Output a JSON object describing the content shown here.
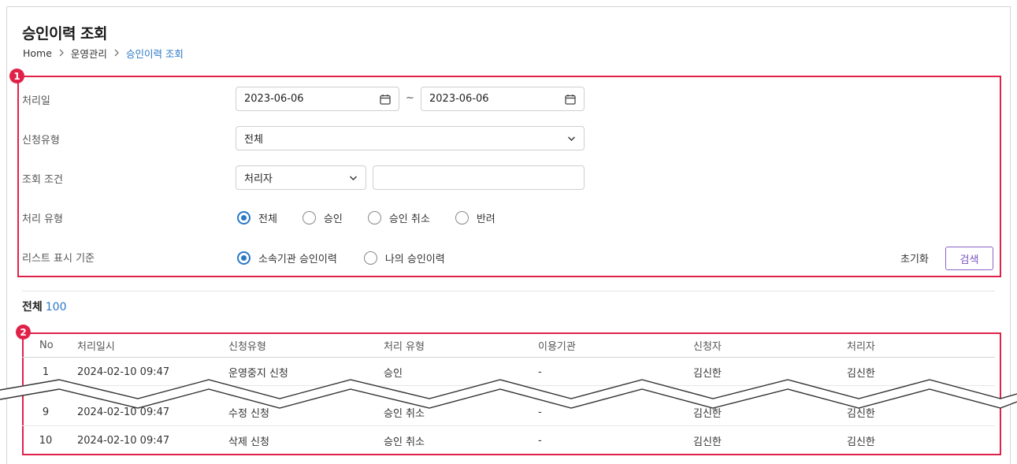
{
  "page": {
    "title": "승인이력 조회",
    "breadcrumb": [
      "Home",
      "운영관리",
      "승인이력 조회"
    ]
  },
  "markers": [
    "1",
    "2"
  ],
  "filters": {
    "date_label": "처리일",
    "date_from": "2023-06-06",
    "date_to": "2023-06-06",
    "date_sep": "~",
    "request_type_label": "신청유형",
    "request_type_value": "전체",
    "search_cond_label": "조회 조건",
    "search_cond_value": "처리자",
    "search_text_value": "",
    "process_type_label": "처리 유형",
    "process_type_options": [
      "전체",
      "승인",
      "승인 취소",
      "반려"
    ],
    "process_type_selected": "전체",
    "list_basis_label": "리스트 표시 기준",
    "list_basis_options": [
      "소속기관 승인이력",
      "나의 승인이력"
    ],
    "list_basis_selected": "소속기관 승인이력",
    "reset_label": "초기화",
    "search_label": "검색"
  },
  "summary": {
    "total_label": "전체",
    "total_count": "100"
  },
  "table": {
    "columns": [
      "No",
      "처리일시",
      "신청유형",
      "처리 유형",
      "이용기관",
      "신청자",
      "처리자"
    ],
    "rows": [
      [
        "1",
        "2024-02-10 09:47",
        "운영중지 신청",
        "승인",
        "-",
        "김신한",
        "김신한"
      ],
      [
        "9",
        "2024-02-10 09:47",
        "수정 신청",
        "승인 취소",
        "-",
        "김신한",
        "김신한"
      ],
      [
        "10",
        "2024-02-10 09:47",
        "삭제 신청",
        "승인 취소",
        "-",
        "김신한",
        "김신한"
      ]
    ]
  },
  "colors": {
    "accent": "#2a78c6",
    "marker": "#e0224a",
    "search_button": "#7a52c0"
  },
  "icons": [
    "calendar-icon",
    "chevron-down-icon",
    "chevron-right-icon"
  ]
}
